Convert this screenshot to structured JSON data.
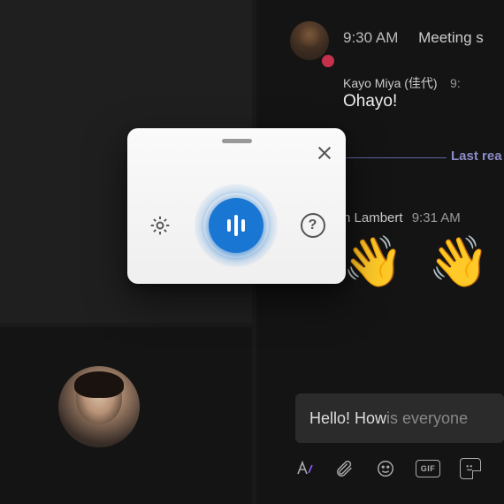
{
  "chat": {
    "header": {
      "time": "9:30 AM",
      "title": "Meeting s"
    },
    "messages": [
      {
        "sender": "Kayo Miya (佳代)",
        "time": "9:",
        "text": "Ohayo!"
      },
      {
        "sender": "n Lambert",
        "time": "9:31 AM",
        "emoji": "👋 👋"
      }
    ],
    "last_read_label": "Last rea",
    "compose": {
      "typed": "Hello! How",
      "placeholder_rest": " is everyone"
    },
    "compose_icons": {
      "format": "format-icon",
      "attach": "attach-icon",
      "emoji": "emoji-icon",
      "gif": "GIF",
      "sticker": "sticker-icon"
    }
  },
  "voice_popup": {
    "settings": "settings-icon",
    "mic": "voice-mic-button",
    "help": "?",
    "close": "close-icon"
  }
}
